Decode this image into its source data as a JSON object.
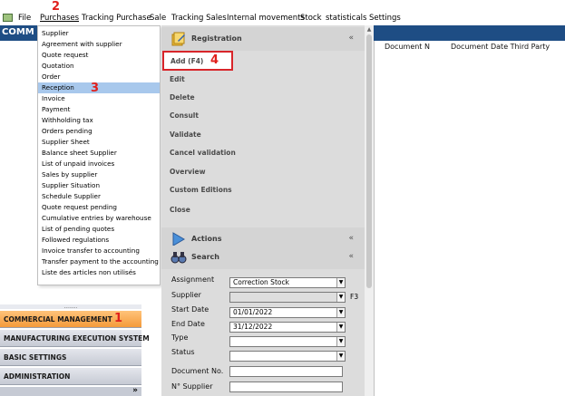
{
  "menubar": {
    "items": [
      "File",
      "Purchases",
      "Tracking Purchase",
      "Sale",
      "Tracking Sales",
      "Internal movements",
      "Stock",
      "statisticals",
      "Settings"
    ]
  },
  "annotations": {
    "n1": "1",
    "n2": "2",
    "n3": "3",
    "n4": "4"
  },
  "header": {
    "title": "COMM"
  },
  "purchases_menu": {
    "items": [
      "Supplier",
      "Agreement with supplier",
      "Quote request",
      "Quotation",
      "Order",
      "Reception",
      "Invoice",
      "Payment",
      "Withholding tax",
      "Orders pending",
      "Supplier Sheet",
      "Balance sheet Supplier",
      "List of unpaid invoices",
      "Sales by supplier",
      "Supplier Situation",
      "Schedule Supplier",
      "Quote request pending",
      "Cumulative entries by warehouse",
      "List of pending quotes",
      "Followed regulations",
      "Invoice transfer to accounting",
      "Transfer payment to the accounting",
      "Liste des articles non utilisés"
    ],
    "selected": "Reception"
  },
  "nav": {
    "dots": "........",
    "modules": [
      "COMMERCIAL MANAGEMENT",
      "MANUFACTURING EXECUTION SYSTEM",
      "BASIC SETTINGS",
      "ADMINISTRATION"
    ],
    "active": "COMMERCIAL MANAGEMENT",
    "expand_glyph": "»"
  },
  "task_panel": {
    "registration": {
      "title": "Registration",
      "chevron": "«",
      "actions": [
        "Add (F4)",
        "Edit",
        "Delete",
        "Consult",
        "Validate",
        "Cancel validation",
        "Overview",
        "Custom Editions",
        "Close"
      ]
    },
    "actions_section": {
      "title": "Actions",
      "chevron": "«"
    },
    "search_section": {
      "title": "Search",
      "chevron": "«"
    },
    "search_form": {
      "assignment": {
        "label": "Assignment",
        "value": "Correction Stock"
      },
      "supplier": {
        "label": "Supplier",
        "value": "",
        "shortcut": "F3"
      },
      "start_date": {
        "label": "Start Date",
        "value": "01/01/2022"
      },
      "end_date": {
        "label": "End Date",
        "value": "31/12/2022"
      },
      "type": {
        "label": "Type",
        "value": ""
      },
      "status": {
        "label": "Status",
        "value": ""
      },
      "document_no": {
        "label": "Document No.",
        "value": ""
      },
      "n_supplier": {
        "label": "N° Supplier",
        "value": ""
      }
    }
  },
  "grid": {
    "columns": [
      "Document N",
      "Document Date Third Party"
    ]
  },
  "colors": {
    "accent_blue": "#1e4d84",
    "active_module": "#f7a447",
    "annotation_red": "#e0201c",
    "selected_item": "#a8c8ec"
  }
}
